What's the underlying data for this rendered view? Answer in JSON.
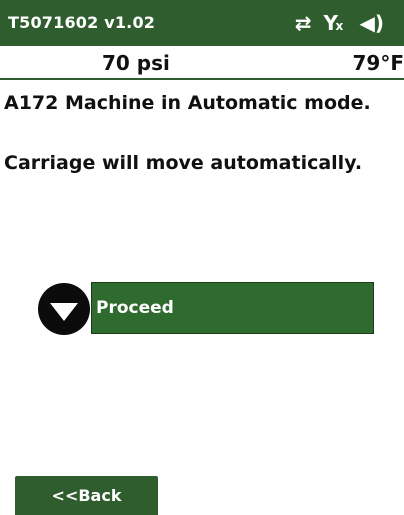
{
  "header": {
    "title": "T5071602 v1.02",
    "icons": [
      "sync-arrows-icon",
      "no-signal-icon",
      "speaker-icon"
    ],
    "background": "#2f5d2e"
  },
  "readout": {
    "pressure": "70 psi",
    "temperature": "79°F"
  },
  "messages": [
    "A172 Machine in Automatic mode.",
    "Carriage will move automatically."
  ],
  "actions": {
    "proceed_label": "Proceed",
    "back_label": "<<Back"
  },
  "colors": {
    "accent": "#2f6a2e",
    "text": "#111111",
    "background": "#ffffff"
  }
}
